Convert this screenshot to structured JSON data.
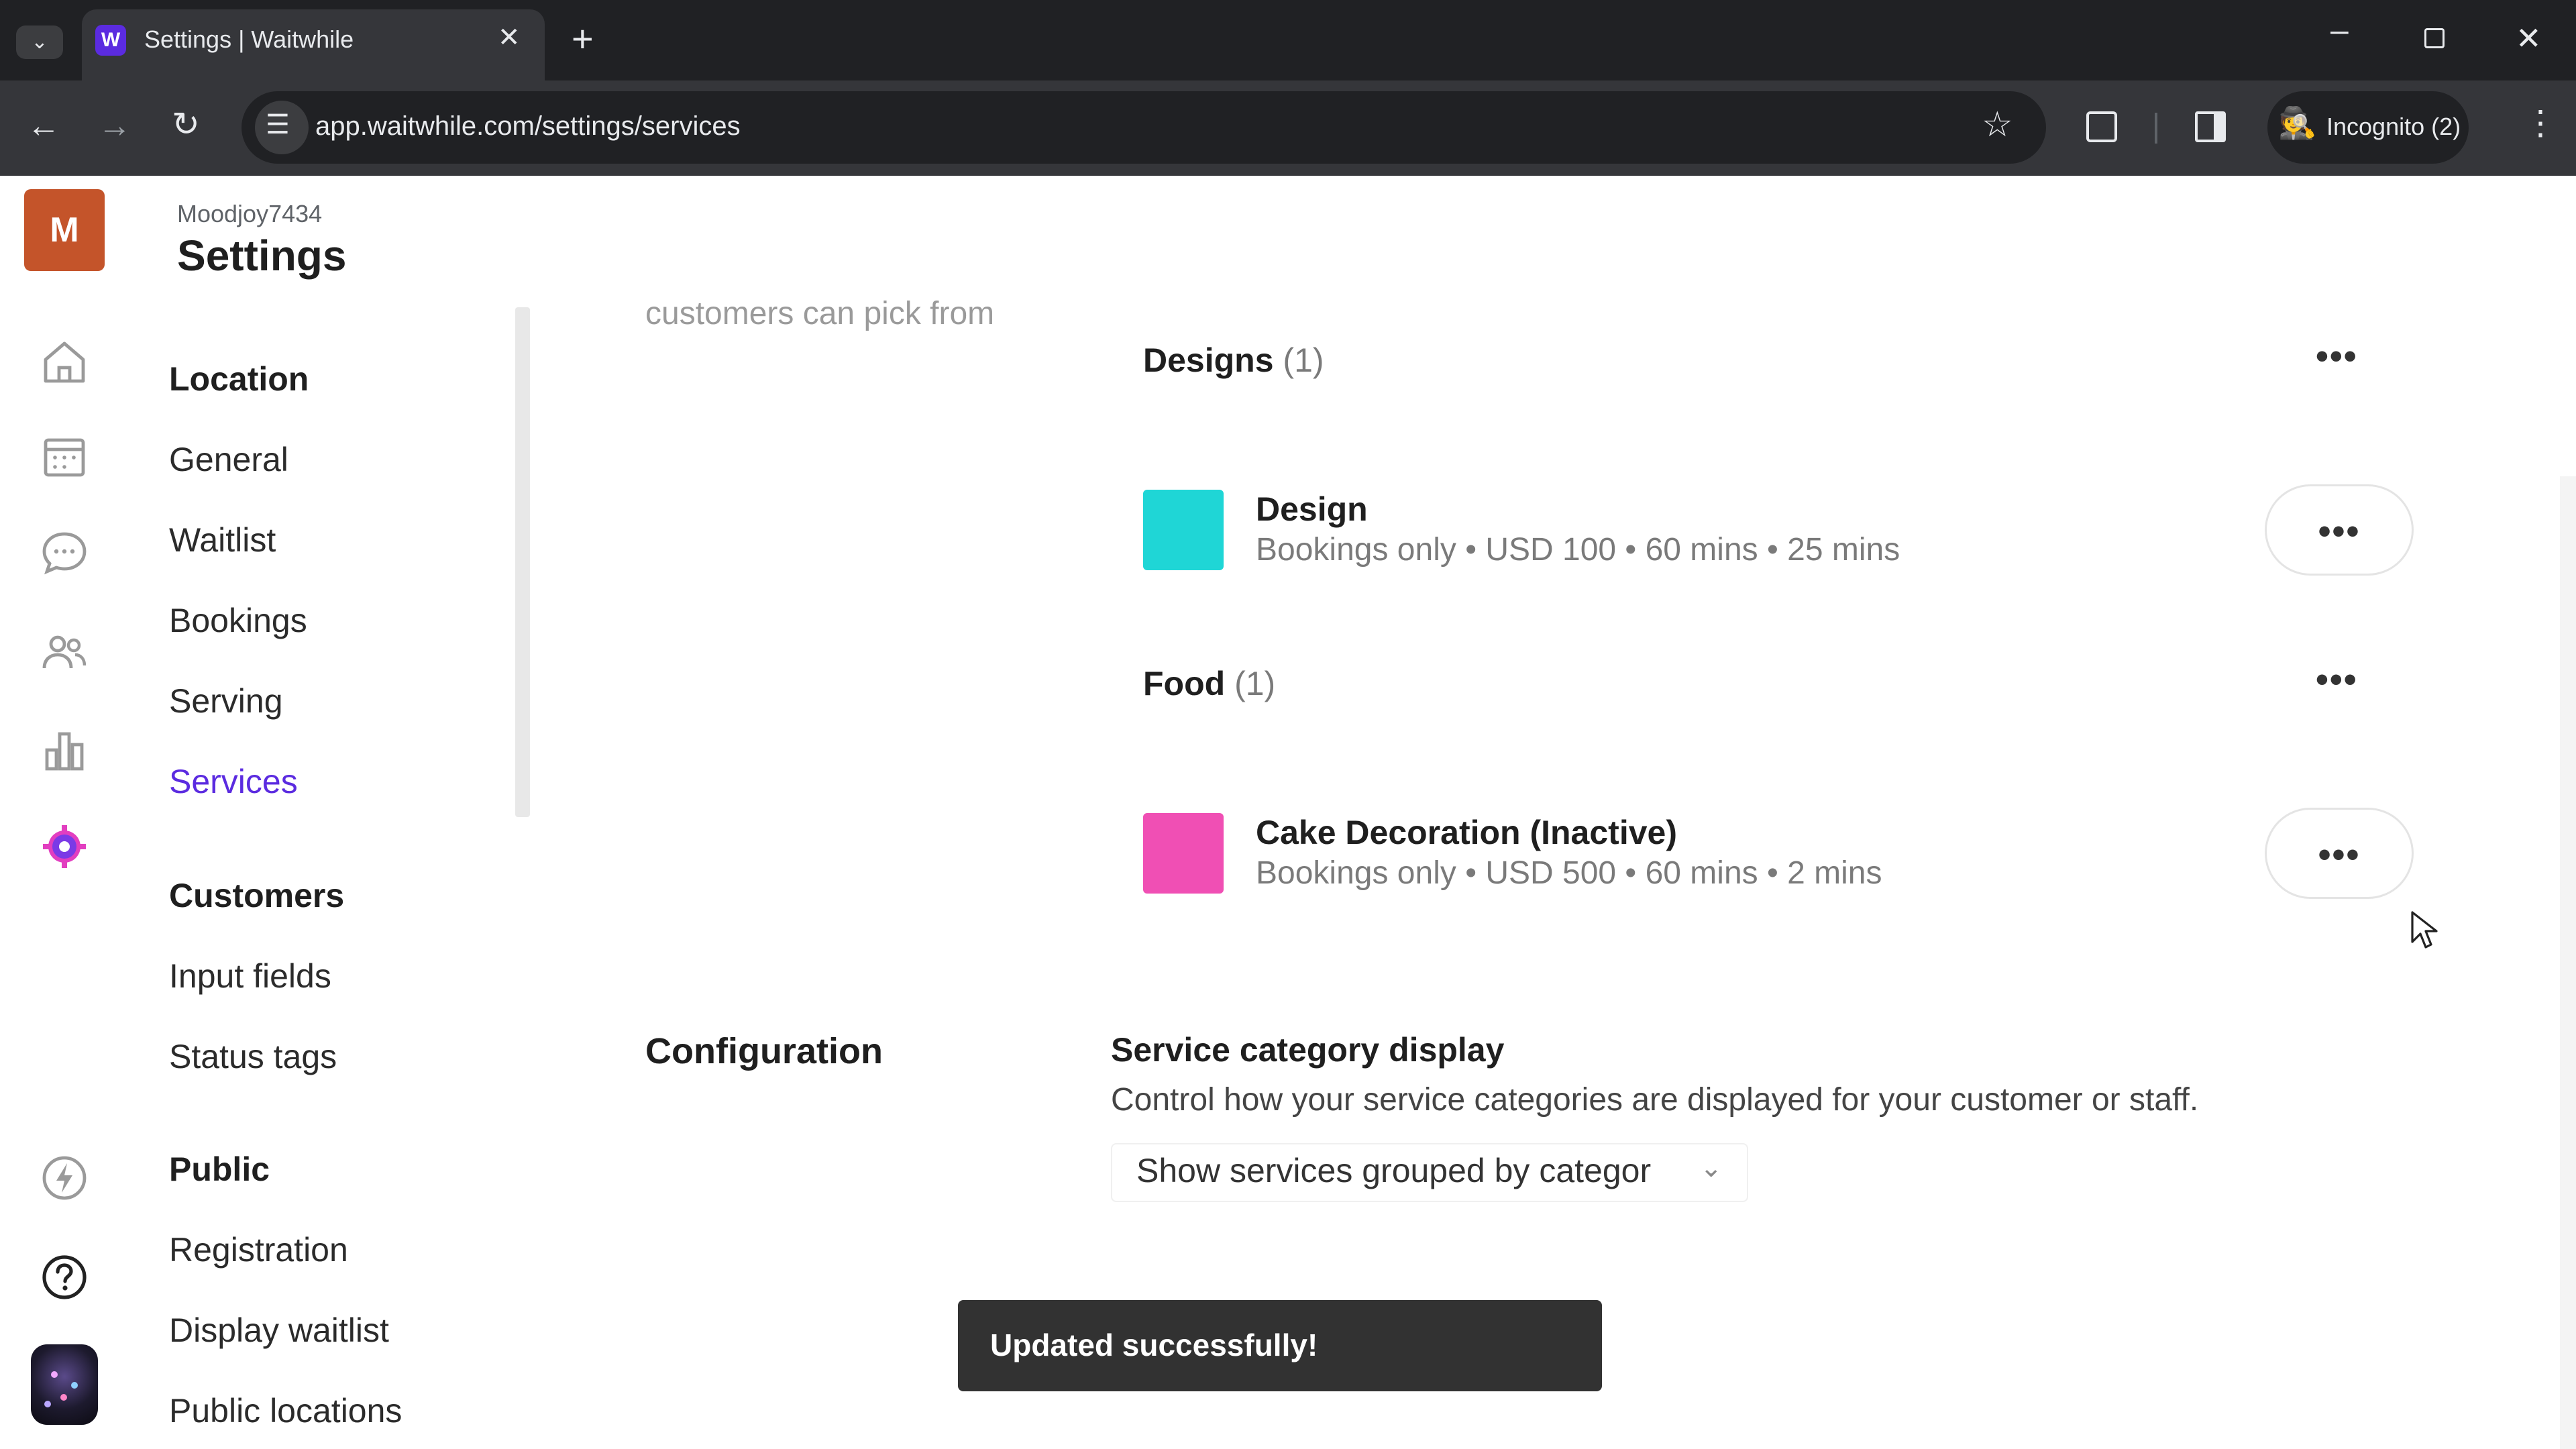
{
  "browser": {
    "tab_title": "Settings | Waitwhile",
    "favicon_letter": "W",
    "url": "app.waitwhile.com/settings/services",
    "incognito_label": "Incognito (2)"
  },
  "app": {
    "location_initial": "M",
    "location_name": "Moodjoy7434",
    "page_title": "Settings"
  },
  "nav": {
    "location_heading": "Location",
    "location_items": [
      "General",
      "Waitlist",
      "Bookings",
      "Serving",
      "Services"
    ],
    "customers_heading": "Customers",
    "customers_items": [
      "Input fields",
      "Status tags"
    ],
    "public_heading": "Public",
    "public_items": [
      "Registration",
      "Display waitlist",
      "Public locations"
    ],
    "active_item": "Services"
  },
  "services_section": {
    "faded_description": "customers can pick from",
    "categories": [
      {
        "name": "Designs",
        "count": "(1)",
        "services": [
          {
            "name": "Design",
            "meta": "Bookings only • USD 100 • 60 mins • 25 mins",
            "color": "#1fd6d6"
          }
        ]
      },
      {
        "name": "Food",
        "count": "(1)",
        "services": [
          {
            "name": "Cake Decoration (Inactive)",
            "meta": "Bookings only • USD 500 • 60 mins • 2 mins",
            "color": "#f04fb4"
          }
        ]
      }
    ],
    "more_label": "•••"
  },
  "configuration": {
    "title": "Configuration",
    "subtitle": "Service category display",
    "description": "Control how your service categories are displayed for your customer or staff.",
    "select_value": "Show services grouped by categor"
  },
  "toast": {
    "message": "Updated successfully!"
  },
  "colors": {
    "accent": "#5b2be0",
    "brand_avatar": "#c4542a",
    "design_swatch": "#1fd6d6",
    "food_swatch": "#f04fb4"
  }
}
